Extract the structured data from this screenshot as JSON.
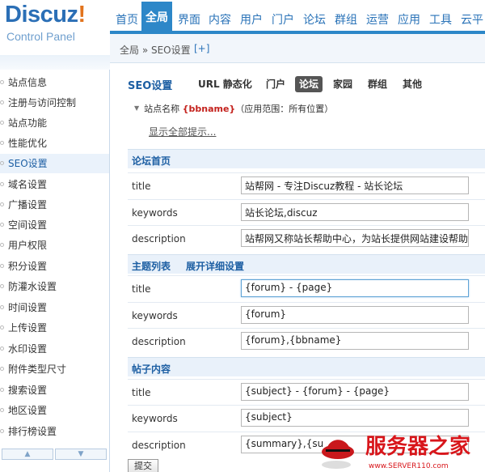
{
  "logo": {
    "brand": "Discuz",
    "bang": "!",
    "subtitle": "Control Panel"
  },
  "topnav": {
    "tabs": [
      {
        "label": "首页"
      },
      {
        "label": "全局"
      },
      {
        "label": "界面"
      },
      {
        "label": "内容"
      },
      {
        "label": "用户"
      },
      {
        "label": "门户"
      },
      {
        "label": "论坛"
      },
      {
        "label": "群组"
      },
      {
        "label": "运营"
      },
      {
        "label": "应用"
      },
      {
        "label": "工具"
      },
      {
        "label": "云平"
      }
    ],
    "active": "全局"
  },
  "breadcrumb": {
    "text": "全局 » SEO设置",
    "plus": "[+]"
  },
  "sidebar": {
    "items": [
      {
        "label": "站点信息"
      },
      {
        "label": "注册与访问控制"
      },
      {
        "label": "站点功能"
      },
      {
        "label": "性能优化"
      },
      {
        "label": "SEO设置"
      },
      {
        "label": "域名设置"
      },
      {
        "label": "广播设置"
      },
      {
        "label": "空间设置"
      },
      {
        "label": "用户权限"
      },
      {
        "label": "积分设置"
      },
      {
        "label": "防灌水设置"
      },
      {
        "label": "时间设置"
      },
      {
        "label": "上传设置"
      },
      {
        "label": "水印设置"
      },
      {
        "label": "附件类型尺寸"
      },
      {
        "label": "搜索设置"
      },
      {
        "label": "地区设置"
      },
      {
        "label": "排行榜设置"
      }
    ],
    "active": "SEO设置",
    "scroll_up": "▲",
    "scroll_down": "▼"
  },
  "main": {
    "title": "SEO设置",
    "subtabs": [
      {
        "label": "URL 静态化"
      },
      {
        "label": "门户"
      },
      {
        "label": "论坛"
      },
      {
        "label": "家园"
      },
      {
        "label": "群组"
      },
      {
        "label": "其他"
      }
    ],
    "active_subtab": "论坛",
    "hint": {
      "prefix": "站点名称 ",
      "variable": "{bbname}",
      "suffix": "（应用范围：所有位置）"
    },
    "show_all": "显示全部提示...",
    "sections": [
      {
        "title": "论坛首页",
        "rows": [
          {
            "label": "title",
            "value": "站帮网 - 专注Discuz教程 - 站长论坛"
          },
          {
            "label": "keywords",
            "value": "站长论坛,discuz"
          },
          {
            "label": "description",
            "value": "站帮网又称站长帮助中心，为站长提供网站建设帮助"
          }
        ]
      },
      {
        "title": "主题列表",
        "link": "展开详细设置",
        "rows": [
          {
            "label": "title",
            "value": "{forum} - {page}"
          },
          {
            "label": "keywords",
            "value": "{forum}"
          },
          {
            "label": "description",
            "value": "{forum},{bbname}"
          }
        ]
      },
      {
        "title": "帖子内容",
        "rows": [
          {
            "label": "title",
            "value": "{subject} - {forum} - {page}"
          },
          {
            "label": "keywords",
            "value": "{subject}"
          },
          {
            "label": "description",
            "value": "{summary},{su"
          }
        ]
      }
    ],
    "submit": "提交"
  },
  "watermark": {
    "text": "服务器之家",
    "url": "www.SERVER110.com"
  }
}
